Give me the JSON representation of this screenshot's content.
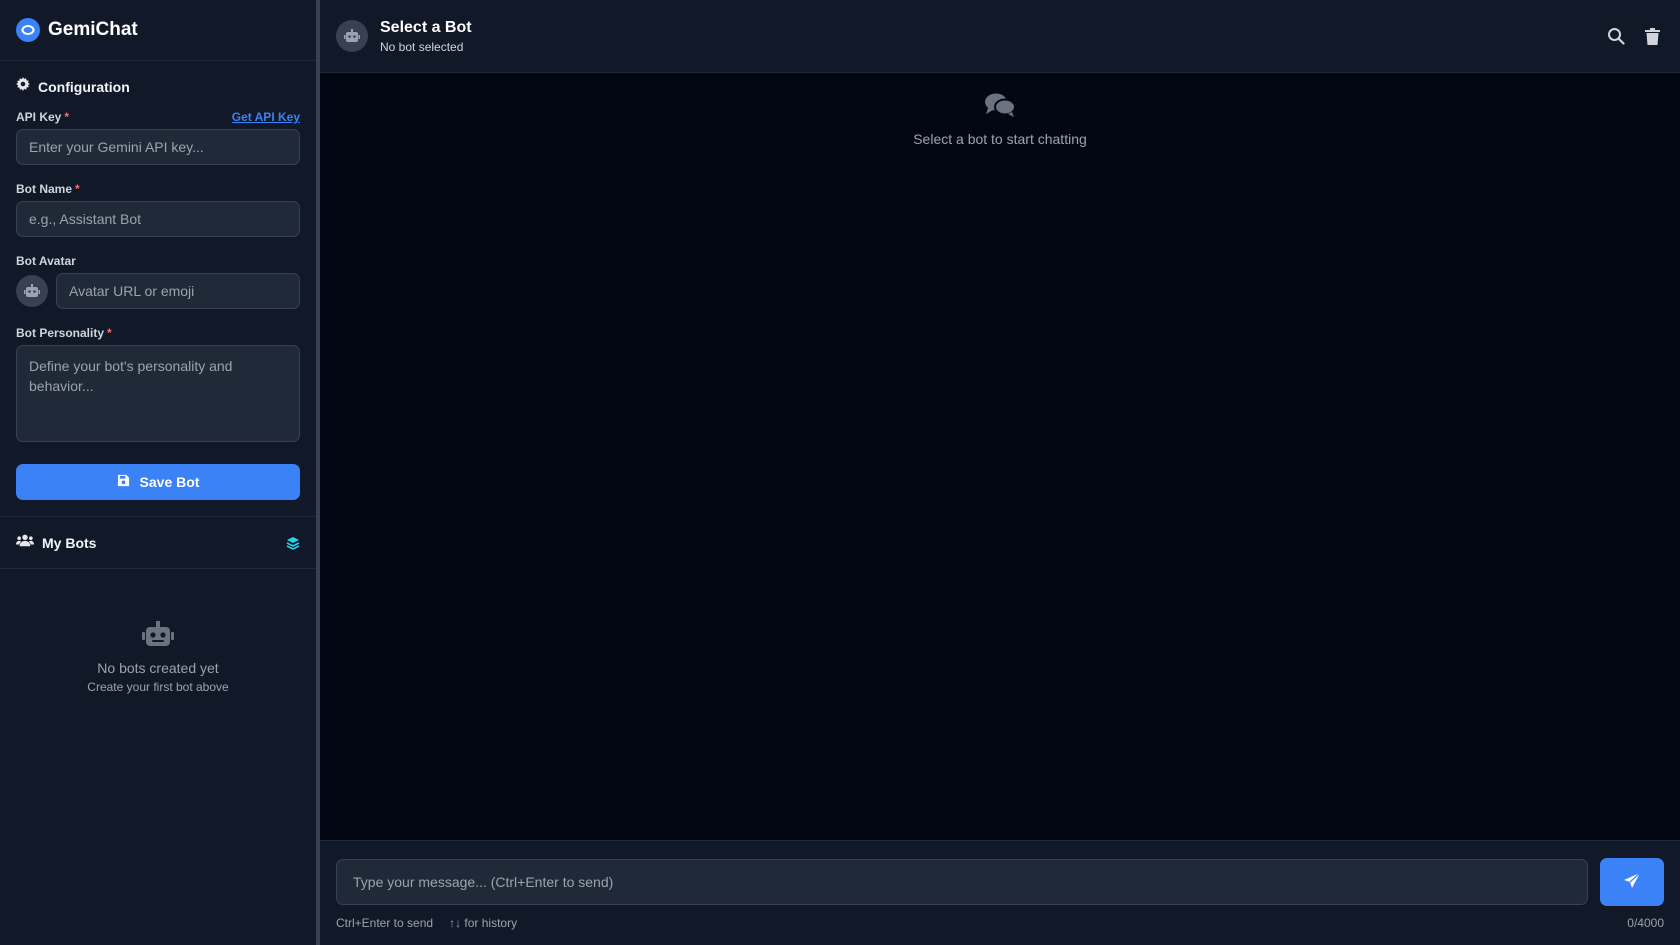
{
  "app": {
    "name": "GemiChat"
  },
  "config": {
    "title": "Configuration",
    "api_key": {
      "label": "API Key",
      "required": "*",
      "link": "Get API Key",
      "placeholder": "Enter your Gemini API key..."
    },
    "bot_name": {
      "label": "Bot Name",
      "required": "*",
      "placeholder": "e.g., Assistant Bot"
    },
    "bot_avatar": {
      "label": "Bot Avatar",
      "placeholder": "Avatar URL or emoji"
    },
    "bot_personality": {
      "label": "Bot Personality",
      "required": "*",
      "placeholder": "Define your bot's personality and behavior..."
    },
    "save_label": "Save Bot"
  },
  "my_bots": {
    "title": "My Bots",
    "empty_title": "No bots created yet",
    "empty_subtitle": "Create your first bot above"
  },
  "chat": {
    "title": "Select a Bot",
    "subtitle": "No bot selected",
    "empty_text": "Select a bot to start chatting",
    "input_placeholder": "Type your message... (Ctrl+Enter to send)",
    "hint_send": "Ctrl+Enter to send",
    "hint_history": "↑↓ for history",
    "char_count": "0/4000"
  },
  "icons": {
    "logo": "chat-bubble-icon",
    "config": "gear-icon",
    "avatar": "robot-icon",
    "save": "floppy-disk-icon",
    "bots": "users-icon",
    "layers": "layers-icon",
    "empty": "robot-icon",
    "search": "search-icon",
    "delete": "trash-icon",
    "chats": "comments-icon",
    "send": "paper-plane-icon"
  },
  "colors": {
    "accent": "#3b82f6",
    "sidebar_bg": "#111827",
    "main_bg": "#030712",
    "input_bg": "#1f2937",
    "required": "#f87171",
    "layers_icon": "#22d3ee"
  }
}
